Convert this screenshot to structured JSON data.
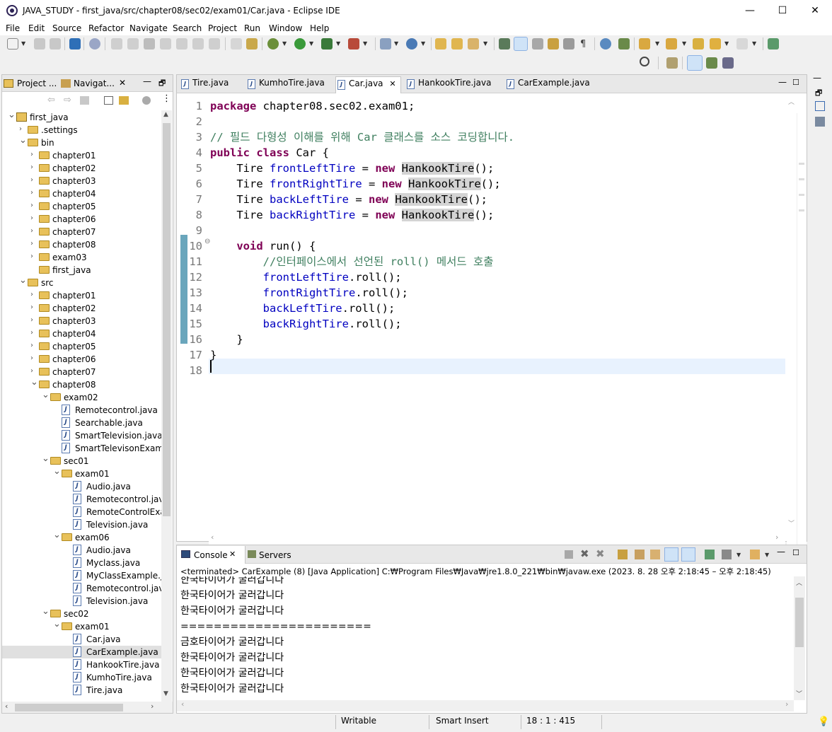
{
  "window": {
    "title": "JAVA_STUDY - first_java/src/chapter08/sec02/exam01/Car.java - Eclipse IDE",
    "minimize": "—",
    "maximize": "☐",
    "close": "✕"
  },
  "menu": [
    "File",
    "Edit",
    "Source",
    "Refactor",
    "Navigate",
    "Search",
    "Project",
    "Run",
    "Window",
    "Help"
  ],
  "left_panel": {
    "tabs": [
      "Project ...",
      "Navigat..."
    ],
    "tree": [
      {
        "label": "first_java",
        "depth": 0,
        "type": "project",
        "expanded": true
      },
      {
        "label": ".settings",
        "depth": 1,
        "type": "folder",
        "expanded": false
      },
      {
        "label": "bin",
        "depth": 1,
        "type": "folder",
        "expanded": true
      },
      {
        "label": "chapter01",
        "depth": 2,
        "type": "folder",
        "expanded": false
      },
      {
        "label": "chapter02",
        "depth": 2,
        "type": "folder",
        "expanded": false
      },
      {
        "label": "chapter03",
        "depth": 2,
        "type": "folder",
        "expanded": false
      },
      {
        "label": "chapter04",
        "depth": 2,
        "type": "folder",
        "expanded": false
      },
      {
        "label": "chapter05",
        "depth": 2,
        "type": "folder",
        "expanded": false
      },
      {
        "label": "chapter06",
        "depth": 2,
        "type": "folder",
        "expanded": false
      },
      {
        "label": "chapter07",
        "depth": 2,
        "type": "folder",
        "expanded": false
      },
      {
        "label": "chapter08",
        "depth": 2,
        "type": "folder",
        "expanded": false
      },
      {
        "label": "exam03",
        "depth": 2,
        "type": "folder",
        "expanded": false
      },
      {
        "label": "first_java",
        "depth": 2,
        "type": "folder",
        "expanded": null
      },
      {
        "label": "src",
        "depth": 1,
        "type": "folder",
        "expanded": true
      },
      {
        "label": "chapter01",
        "depth": 2,
        "type": "folder",
        "expanded": false
      },
      {
        "label": "chapter02",
        "depth": 2,
        "type": "folder",
        "expanded": false
      },
      {
        "label": "chapter03",
        "depth": 2,
        "type": "folder",
        "expanded": false
      },
      {
        "label": "chapter04",
        "depth": 2,
        "type": "folder",
        "expanded": false
      },
      {
        "label": "chapter05",
        "depth": 2,
        "type": "folder",
        "expanded": false
      },
      {
        "label": "chapter06",
        "depth": 2,
        "type": "folder",
        "expanded": false
      },
      {
        "label": "chapter07",
        "depth": 2,
        "type": "folder",
        "expanded": false
      },
      {
        "label": "chapter08",
        "depth": 2,
        "type": "folder",
        "expanded": true
      },
      {
        "label": "exam02",
        "depth": 3,
        "type": "folder",
        "expanded": true
      },
      {
        "label": "Remotecontrol.java",
        "depth": 4,
        "type": "java",
        "expanded": null
      },
      {
        "label": "Searchable.java",
        "depth": 4,
        "type": "java",
        "expanded": null
      },
      {
        "label": "SmartTelevision.java",
        "depth": 4,
        "type": "java",
        "expanded": null
      },
      {
        "label": "SmartTelevisonExamp",
        "depth": 4,
        "type": "java",
        "expanded": null
      },
      {
        "label": "sec01",
        "depth": 3,
        "type": "folder",
        "expanded": true
      },
      {
        "label": "exam01",
        "depth": 4,
        "type": "folder",
        "expanded": true
      },
      {
        "label": "Audio.java",
        "depth": 5,
        "type": "java",
        "expanded": null
      },
      {
        "label": "Remotecontrol.java",
        "depth": 5,
        "type": "java",
        "expanded": null
      },
      {
        "label": "RemoteControlExar",
        "depth": 5,
        "type": "java",
        "expanded": null
      },
      {
        "label": "Television.java",
        "depth": 5,
        "type": "java",
        "expanded": null
      },
      {
        "label": "exam06",
        "depth": 4,
        "type": "folder",
        "expanded": true
      },
      {
        "label": "Audio.java",
        "depth": 5,
        "type": "java",
        "expanded": null
      },
      {
        "label": "Myclass.java",
        "depth": 5,
        "type": "java",
        "expanded": null
      },
      {
        "label": "MyClassExample.ja",
        "depth": 5,
        "type": "java",
        "expanded": null
      },
      {
        "label": "Remotecontrol.java",
        "depth": 5,
        "type": "java",
        "expanded": null
      },
      {
        "label": "Television.java",
        "depth": 5,
        "type": "java",
        "expanded": null
      },
      {
        "label": "sec02",
        "depth": 3,
        "type": "folder",
        "expanded": true
      },
      {
        "label": "exam01",
        "depth": 4,
        "type": "folder",
        "expanded": true
      },
      {
        "label": "Car.java",
        "depth": 5,
        "type": "java",
        "expanded": null
      },
      {
        "label": "CarExample.java",
        "depth": 5,
        "type": "java",
        "expanded": null,
        "selected": true
      },
      {
        "label": "HankookTire.java",
        "depth": 5,
        "type": "java",
        "expanded": null
      },
      {
        "label": "KumhoTire.java",
        "depth": 5,
        "type": "java",
        "expanded": null
      },
      {
        "label": "Tire.java",
        "depth": 5,
        "type": "java",
        "expanded": null
      }
    ]
  },
  "editor": {
    "tabs": [
      "Tire.java",
      "KumhoTire.java",
      "Car.java",
      "HankookTire.java",
      "CarExample.java"
    ],
    "active_tab": "Car.java",
    "line_numbers": [
      "1",
      "2",
      "3",
      "4",
      "5",
      "6",
      "7",
      "8",
      "9",
      "10",
      "11",
      "12",
      "13",
      "14",
      "15",
      "16",
      "17",
      "18"
    ],
    "lines": [
      {
        "text_pkg_kw": "package",
        "text_pkg": " chapter08.sec02.exam01;"
      },
      {},
      {
        "comment": "// 필드 다형성 이해를 위해 Car 클래스를 소스 코딩합니다."
      },
      {
        "kw1": "public",
        "kw2": "class",
        "rest": " Car {"
      },
      {
        "type": "Tire",
        "field": "frontLeftTire",
        "op": " = ",
        "kw": "new",
        "cls": "HankookTire",
        "end": "();"
      },
      {
        "type": "Tire",
        "field": "frontRightTire",
        "op": " = ",
        "kw": "new",
        "cls": "HankookTire",
        "end": "();"
      },
      {
        "type": "Tire",
        "field": "backLeftTire",
        "op": " = ",
        "kw": "new",
        "cls": "HankookTire",
        "end": "();"
      },
      {
        "type": "Tire",
        "field": "backRightTire",
        "op": " = ",
        "kw": "new",
        "cls": "HankookTire",
        "end": "();"
      },
      {},
      {
        "kw": "void",
        "rest": " run() {"
      },
      {
        "comment": "//인터페이스에서 선언된 roll() 메서드 호출"
      },
      {
        "field": "frontLeftTire",
        "rest": ".roll();"
      },
      {
        "field": "frontRightTire",
        "rest": ".roll();"
      },
      {
        "field": "backLeftTire",
        "rest": ".roll();"
      },
      {
        "field": "backRightTire",
        "rest": ".roll();"
      },
      {
        "rest": "}"
      },
      {
        "rest": "}"
      },
      {}
    ]
  },
  "console": {
    "tabs": [
      "Console",
      "Servers"
    ],
    "header": "<terminated> CarExample (8) [Java Application] C:₩Program Files₩Java₩jre1.8.0_221₩bin₩javaw.exe  (2023. 8. 28 오후 2:18:45 – 오후 2:18:45)",
    "output": [
      "한국타이어가 굴러갑니다",
      "한국타이어가 굴러갑니다",
      "한국타이어가 굴러갑니다",
      "=======================",
      "금호타이어가 굴러갑니다",
      "한국타이어가 굴러갑니다",
      "한국타이어가 굴러갑니다",
      "한국타이어가 굴러갑니다"
    ]
  },
  "status": {
    "mode": "Writable",
    "insert": "Smart Insert",
    "position": "18 : 1 : 415"
  },
  "colors": {
    "keyword": "#7f0055",
    "field": "#0000c0",
    "comment": "#3f7f5f",
    "current_line": "#e8f2fe",
    "change_bar": "#6aa6bc"
  }
}
